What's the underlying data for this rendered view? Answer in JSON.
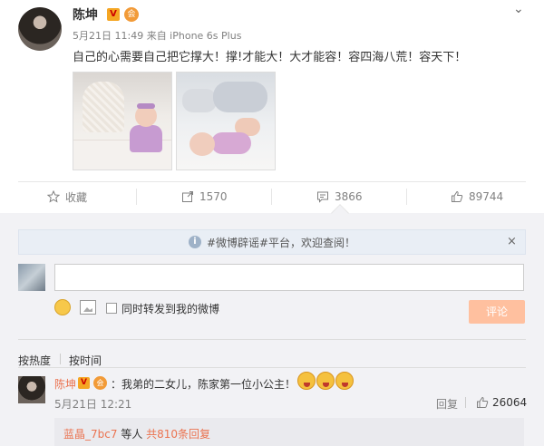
{
  "post": {
    "author": "陈坤",
    "verified_badge": "V",
    "vip_badge": "会",
    "meta": "5月21日 11:49 来自 iPhone 6s Plus",
    "text": "自己的心需要自己把它撑大！撑!才能大！大才能容！容四海八荒！容天下！",
    "more_icon": "chevron-down-icon"
  },
  "actions": {
    "favorite_label": "收藏",
    "repost_count": "1570",
    "comment_count": "3866",
    "like_count": "89744"
  },
  "comments": {
    "notice": "#微博辟谣#平台，欢迎查阅！",
    "notice_close": "×",
    "input_placeholder": "",
    "repost_checkbox_label": "同时转发到我的微博",
    "submit_label": "评论",
    "sort_hot": "按热度",
    "sort_time": "按时间",
    "items": [
      {
        "author": "陈坤",
        "text": "：我弟的二女儿，陈家第一位小公主！",
        "time": "5月21日 12:21",
        "reply_label": "回复",
        "likes": "26064",
        "sub_reply_user": "蓝晶_7bc7",
        "sub_reply_text": " 等人 ",
        "sub_reply_count": "共810条回复"
      }
    ]
  },
  "colors": {
    "accent_orange": "#eb7350",
    "submit_disabled": "#ffc09f",
    "panel_bg": "#f2f2f5"
  }
}
